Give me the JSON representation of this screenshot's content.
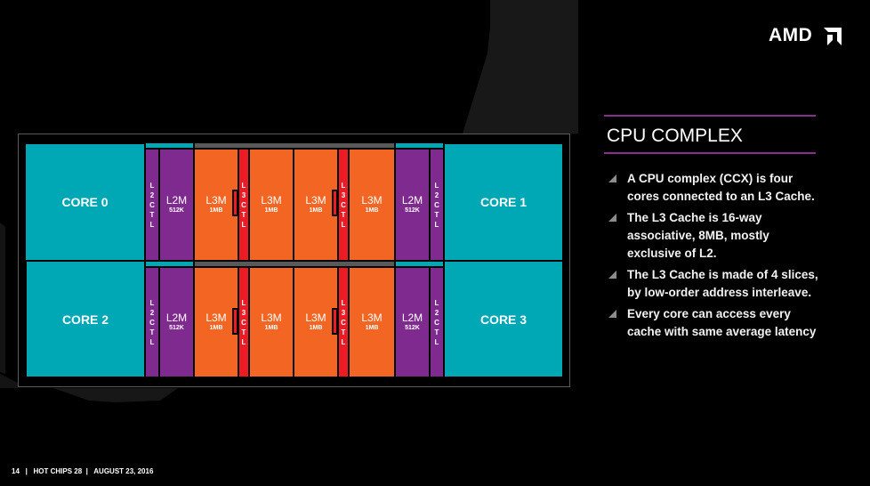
{
  "slide": {
    "logo_text": "AMD",
    "title": "CPU COMPLEX",
    "bullets": [
      "A CPU complex (CCX) is four cores connected to an L3 Cache.",
      "The L3 Cache is 16-way associative, 8MB, mostly exclusive of L2.",
      "The L3 Cache is made of 4 slices, by low-order address interleave.",
      "Every core can access every cache with same average latency"
    ],
    "footer": {
      "page": "14",
      "event": "HOT CHIPS 28",
      "date": "AUGUST 23, 2016",
      "separator": "|"
    }
  },
  "diagram": {
    "cores": [
      "CORE 0",
      "CORE 1",
      "CORE 2",
      "CORE 3"
    ],
    "l2ctl_letters": [
      "L",
      "2",
      "C",
      "T",
      "L"
    ],
    "l3ctl_letters": [
      "L",
      "3",
      "C",
      "T",
      "L"
    ],
    "l2m": {
      "name": "L2M",
      "size": "512K"
    },
    "l3m": {
      "name": "L3M",
      "size": "1MB"
    }
  },
  "colors": {
    "core": "#00a8b5",
    "l2": "#7f2a8e",
    "l3m": "#f26522",
    "l3ctl": "#ed1c24",
    "interconnect": "#595959",
    "accent_rule": "#8a2f8f"
  }
}
